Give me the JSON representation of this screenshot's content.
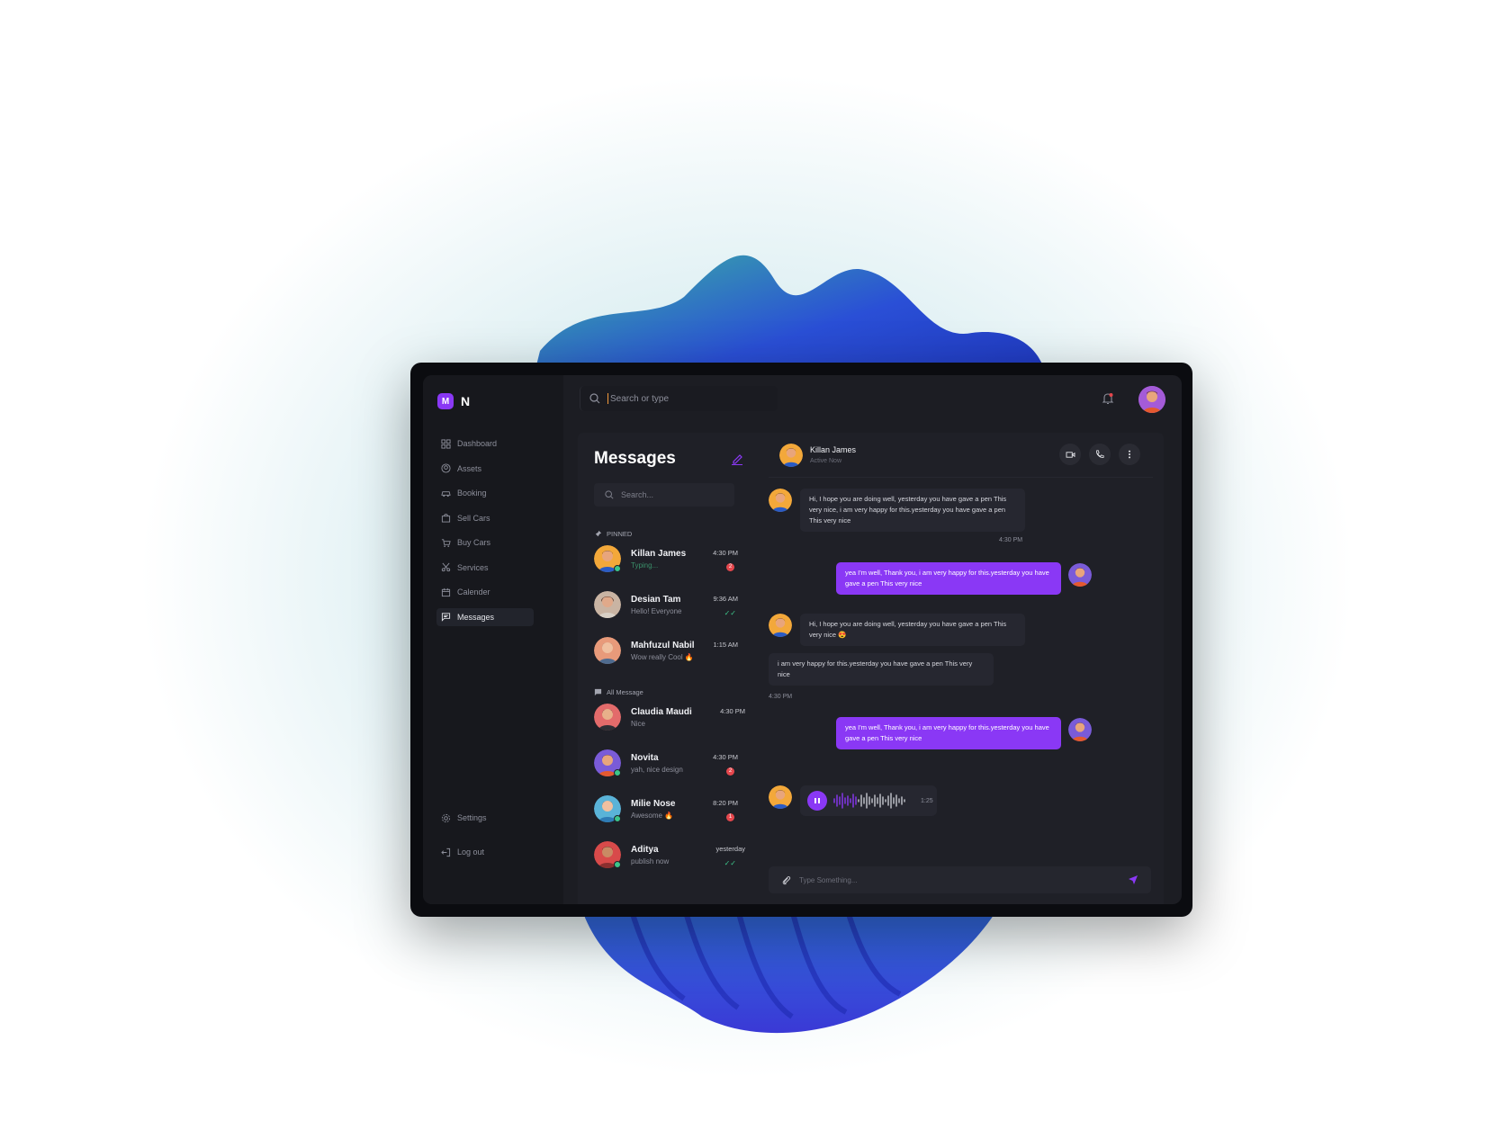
{
  "app": {
    "logo_letter": "M",
    "logo_text": "N"
  },
  "colors": {
    "accent": "#8a38f5",
    "online": "#3cc58a",
    "badge": "#e5474d",
    "background": "#1c1d23"
  },
  "sidebar": {
    "items": [
      {
        "label": "Dashboard",
        "icon": "grid-icon"
      },
      {
        "label": "Assets",
        "icon": "user-circle-icon"
      },
      {
        "label": "Booking",
        "icon": "car-icon"
      },
      {
        "label": "Sell Cars",
        "icon": "bag-icon"
      },
      {
        "label": "Buy Cars",
        "icon": "cart-icon"
      },
      {
        "label": "Services",
        "icon": "scissors-icon"
      },
      {
        "label": "Calender",
        "icon": "calendar-icon"
      },
      {
        "label": "Messages",
        "icon": "chat-icon",
        "active": true
      }
    ],
    "bottom": [
      {
        "label": "Settings",
        "icon": "gear-icon"
      },
      {
        "label": "Log out",
        "icon": "logout-icon"
      }
    ]
  },
  "topbar": {
    "search_placeholder": "Search or type"
  },
  "messages_panel": {
    "title": "Messages",
    "search_placeholder": "Search...",
    "pinned_label": "PINNED",
    "all_label": "All Message",
    "pinned": [
      {
        "name": "Killan James",
        "preview": "Typing...",
        "time": "4:30 PM",
        "badge": "2",
        "online": true,
        "typing": true
      },
      {
        "name": "Desian Tam",
        "preview": "Hello! Everyone",
        "time": "9:36 AM",
        "read": true
      },
      {
        "name": "Mahfuzul Nabil",
        "preview": "Wow really Cool 🔥",
        "time": "1:15 AM"
      }
    ],
    "all": [
      {
        "name": "Claudia Maudi",
        "preview": "Nice",
        "time": "4:30 PM"
      },
      {
        "name": "Novita",
        "preview": "yah, nice design",
        "time": "4:30 PM",
        "badge": "2",
        "online": true
      },
      {
        "name": "Milie Nose",
        "preview": "Awesome 🔥",
        "time": "8:20 PM",
        "badge": "1",
        "online": true
      },
      {
        "name": "Aditya",
        "preview": "publish now",
        "time": "yesterday",
        "read": true,
        "online": true
      }
    ]
  },
  "chat": {
    "name": "Killan James",
    "status": "Active Now",
    "messages": [
      {
        "dir": "in",
        "text": "Hi, I hope you are doing well, yesterday you have gave a pen This very nice, i am very happy for this.yesterday you have gave a pen This very nice"
      },
      {
        "time": "4:30 PM"
      },
      {
        "dir": "out",
        "text": "yea I'm well, Thank you, i am very happy for this.yesterday you have gave a pen This very nice"
      },
      {
        "dir": "in",
        "text": "Hi, I hope you are doing well, yesterday you have gave a pen This very nice 😍"
      },
      {
        "dir": "in",
        "text": "i am very happy for this.yesterday you have gave a pen This very nice"
      },
      {
        "time": "4:30 PM"
      },
      {
        "dir": "out",
        "text": "yea I'm well, Thank you, i am very happy for this.yesterday you have gave a pen This very nice"
      }
    ],
    "voice": {
      "duration": "1:25"
    },
    "composer_placeholder": "Type Something..."
  }
}
